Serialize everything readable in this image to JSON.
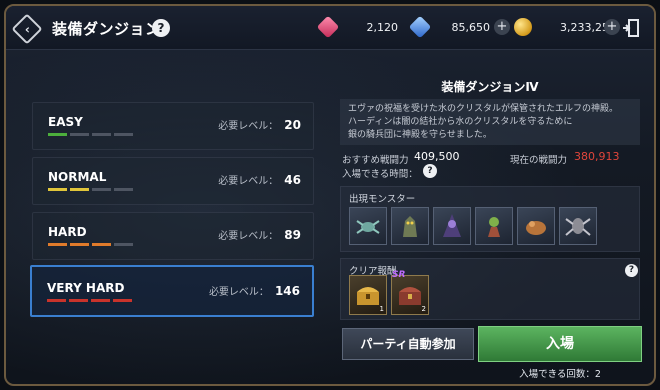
{
  "header": {
    "title": "装備ダンジョン",
    "help_label": "?",
    "resources": {
      "gem_red": "2,120",
      "gem_blue": "85,650",
      "gold": "3,233,259"
    },
    "plus_label": "+"
  },
  "difficulties": [
    {
      "name": "EASY",
      "req_label": "必要レベル：",
      "req_value": "20",
      "bar_color": "#4cae3c",
      "filled": 1
    },
    {
      "name": "NORMAL",
      "req_label": "必要レベル：",
      "req_value": "46",
      "bar_color": "#e0c53a",
      "filled": 2
    },
    {
      "name": "HARD",
      "req_label": "必要レベル：",
      "req_value": "89",
      "bar_color": "#e07b2b",
      "filled": 3
    },
    {
      "name": "VERY HARD",
      "req_label": "必要レベル：",
      "req_value": "146",
      "bar_color": "#c8332b",
      "filled": 4
    }
  ],
  "selected_difficulty": "VERY HARD",
  "detail": {
    "title": "装備ダンジョンⅣ",
    "description_lines": [
      "エヴァの祝福を受けた水のクリスタルが保管されたエルフの神殿。",
      "ハーディンは闇の結社から水のクリスタルを守るために",
      "銀の騎兵団に神殿を守らせました。"
    ],
    "recommended_label": "おすすめ戦闘力",
    "recommended_value": "409,500",
    "current_label": "現在の戦闘力",
    "current_value": "380,913",
    "time_label": "入場できる時間：",
    "monsters_label": "出現モンスター",
    "monsters": [
      "spider-monster-icon",
      "golem-monster-icon",
      "dark-mage-monster-icon",
      "goblin-monster-icon",
      "beast-monster-icon",
      "spider-knight-monster-icon"
    ],
    "rewards_label": "クリア報酬",
    "rewards": [
      {
        "icon": "gold-chest-icon",
        "count": "1",
        "badge": ""
      },
      {
        "icon": "sr-chest-icon",
        "count": "2",
        "badge": "SR"
      }
    ]
  },
  "buttons": {
    "party": "パーティ自動参加",
    "enter": "入場",
    "enter_count": "入場できる回数：2"
  },
  "colors": {
    "accent_select": "#3a7fd0",
    "enter_green": "#4ea552",
    "current_power_red": "#e0453b"
  }
}
